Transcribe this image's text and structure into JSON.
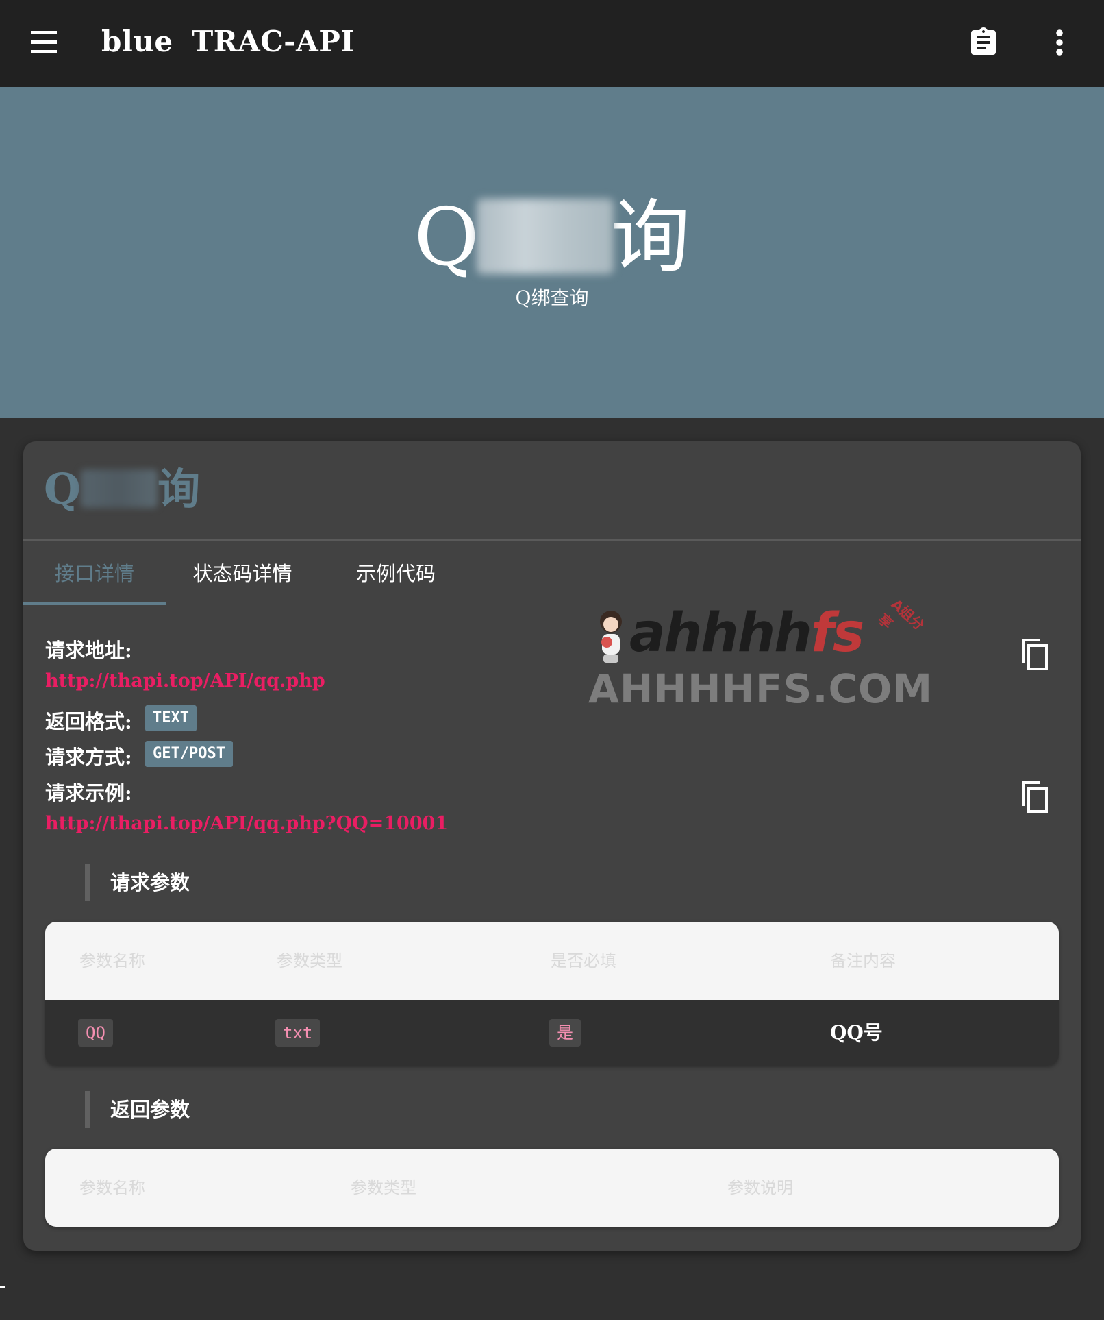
{
  "appbar": {
    "brand": "blue",
    "title": "TRAC-API",
    "menu_icon": "menu-icon",
    "clipboard_icon": "clipboard-icon",
    "more_icon": "more-vert-icon"
  },
  "hero": {
    "title_start": "Q",
    "title_end": "询",
    "subtitle": "Q绑查询"
  },
  "card": {
    "title_start": "Q",
    "title_end": "询",
    "tabs": [
      {
        "label": "接口详情",
        "active": true
      },
      {
        "label": "状态码详情",
        "active": false
      },
      {
        "label": "示例代码",
        "active": false
      }
    ],
    "request_url_label": "请求地址:",
    "request_url": "http://thapi.top/API/qq.php",
    "return_format_label": "返回格式:",
    "return_format": "TEXT",
    "request_method_label": "请求方式:",
    "request_method": "GET/POST",
    "request_example_label": "请求示例:",
    "request_example": "http://thapi.top/API/qq.php?QQ=10001"
  },
  "watermark": {
    "script_dark": "ahhhh",
    "script_red": "fs",
    "tag": "A姐分享",
    "domain": "AHHHHFS.COM"
  },
  "request_params": {
    "heading": "请求参数",
    "columns": [
      "参数名称",
      "参数类型",
      "是否必填",
      "备注内容"
    ],
    "rows": [
      {
        "name": "QQ",
        "type": "txt",
        "required": "是",
        "note": "QQ号"
      }
    ]
  },
  "return_params": {
    "heading": "返回参数",
    "columns": [
      "参数名称",
      "参数类型",
      "参数说明"
    ]
  },
  "colors": {
    "appbar": "#212121",
    "hero": "#607d8b",
    "card": "#424242",
    "accent": "#607d8b",
    "link": "#e91e63"
  }
}
